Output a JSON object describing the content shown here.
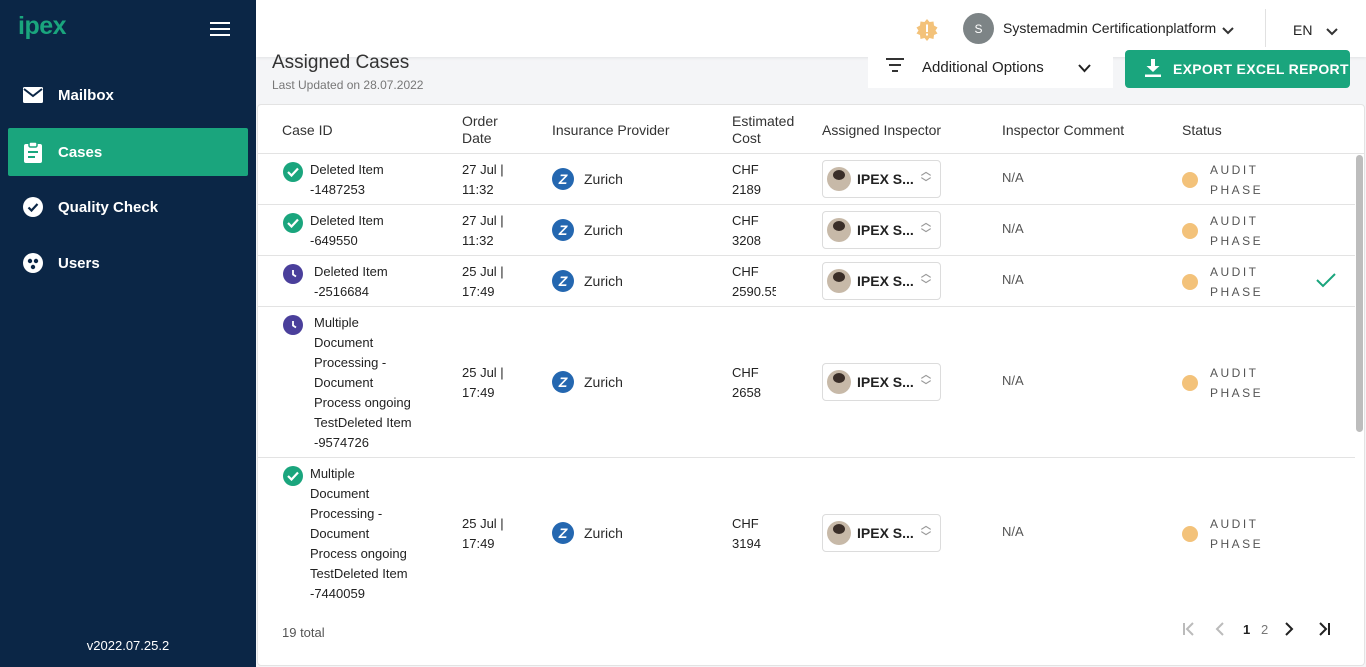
{
  "sidebar": {
    "logo": "ipex",
    "items": [
      {
        "label": "Mailbox"
      },
      {
        "label": "Cases"
      },
      {
        "label": "Quality Check"
      },
      {
        "label": "Users"
      }
    ],
    "version": "v2022.07.25.2"
  },
  "topbar": {
    "avatar_initial": "S",
    "username": "Systemadmin Certificationplatform",
    "language": "EN"
  },
  "page": {
    "title": "Assigned Cases",
    "last_updated": "Last Updated on 28.07.2022",
    "additional_options": "Additional Options",
    "export_button": "EXPORT EXCEL REPORT"
  },
  "table": {
    "headers": {
      "case_id": "Case ID",
      "order_date_1": "Order",
      "order_date_2": "Date",
      "provider": "Insurance Provider",
      "cost_1": "Estimated",
      "cost_2": "Cost",
      "inspector": "Assigned Inspector",
      "comment": "Inspector Comment",
      "status": "Status"
    },
    "rows": [
      {
        "icon": "check-circle-icon",
        "case_lines": [
          "Deleted Item",
          "-1487253"
        ],
        "date_1": "27 Jul |",
        "date_2": "11:32",
        "provider": "Zurich",
        "cost_1": "CHF",
        "cost_2": "2189",
        "inspector": "IPEX S...",
        "comment": "N/A",
        "status_1": "AUDIT",
        "status_2": "PHASE"
      },
      {
        "icon": "check-circle-icon",
        "case_lines": [
          "Deleted Item",
          "-649550"
        ],
        "date_1": "27 Jul |",
        "date_2": "11:32",
        "provider": "Zurich",
        "cost_1": "CHF",
        "cost_2": "3208",
        "inspector": "IPEX S...",
        "comment": "N/A",
        "status_1": "AUDIT",
        "status_2": "PHASE"
      },
      {
        "icon": "clock-icon",
        "case_lines": [
          "Deleted Item",
          "-2516684"
        ],
        "date_1": "25 Jul |",
        "date_2": "17:49",
        "provider": "Zurich",
        "cost_1": "CHF",
        "cost_2": "2590.55",
        "inspector": "IPEX S...",
        "comment": "N/A",
        "status_1": "AUDIT",
        "status_2": "PHASE"
      },
      {
        "icon": "clock-icon",
        "case_lines": [
          "Multiple",
          "Document",
          "Processing -",
          "Document",
          "Process ongoing",
          "TestDeleted Item",
          "-9574726"
        ],
        "date_1": "25 Jul |",
        "date_2": "17:49",
        "provider": "Zurich",
        "cost_1": "CHF",
        "cost_2": "2658",
        "inspector": "IPEX S...",
        "comment": "N/A",
        "status_1": "AUDIT",
        "status_2": "PHASE"
      },
      {
        "icon": "check-circle-icon",
        "case_lines": [
          "Multiple",
          "Document",
          "Processing -",
          "Document",
          "Process ongoing",
          "TestDeleted Item",
          "-7440059"
        ],
        "date_1": "25 Jul |",
        "date_2": "17:49",
        "provider": "Zurich",
        "cost_1": "CHF",
        "cost_2": "3194",
        "inspector": "IPEX S...",
        "comment": "N/A",
        "status_1": "AUDIT",
        "status_2": "PHASE"
      }
    ]
  },
  "footer": {
    "total": "19 total",
    "pages": [
      "1",
      "2"
    ]
  },
  "colors": {
    "sidebar_bg": "#0b2646",
    "accent": "#1aa57d",
    "pending": "#4a3f9b",
    "status_dot": "#f3c27a"
  }
}
